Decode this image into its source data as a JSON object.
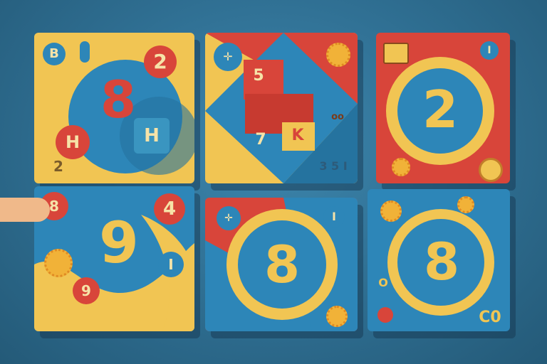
{
  "tiles": {
    "t1": {
      "big_number": "8",
      "badge_top_left": "B",
      "badge_top_right": "2",
      "badge_left": "H",
      "badge_right": "H",
      "corner_text": "2"
    },
    "t2": {
      "block_label": "5",
      "block_label_small": "..",
      "mid_left": "7",
      "mid_right": "K",
      "right_text": "oo",
      "corner_text": "3 5 I"
    },
    "t3": {
      "big_number": "2"
    },
    "t4": {
      "big_number": "9",
      "badge_top": "4",
      "badge_left": "8",
      "badge_bottom": "9"
    },
    "t5": {
      "big_number": "8"
    },
    "t6": {
      "big_number": "8",
      "left_text": "O",
      "corner_text": "C0"
    }
  },
  "colors": {
    "background": "#2f6f93",
    "yellow": "#f1c553",
    "red": "#d8453a",
    "blue": "#2d86b8",
    "cream": "#f6e3a8"
  },
  "icons": [
    "hand-icon",
    "sun-icon",
    "calendar-icon",
    "key-icon"
  ]
}
